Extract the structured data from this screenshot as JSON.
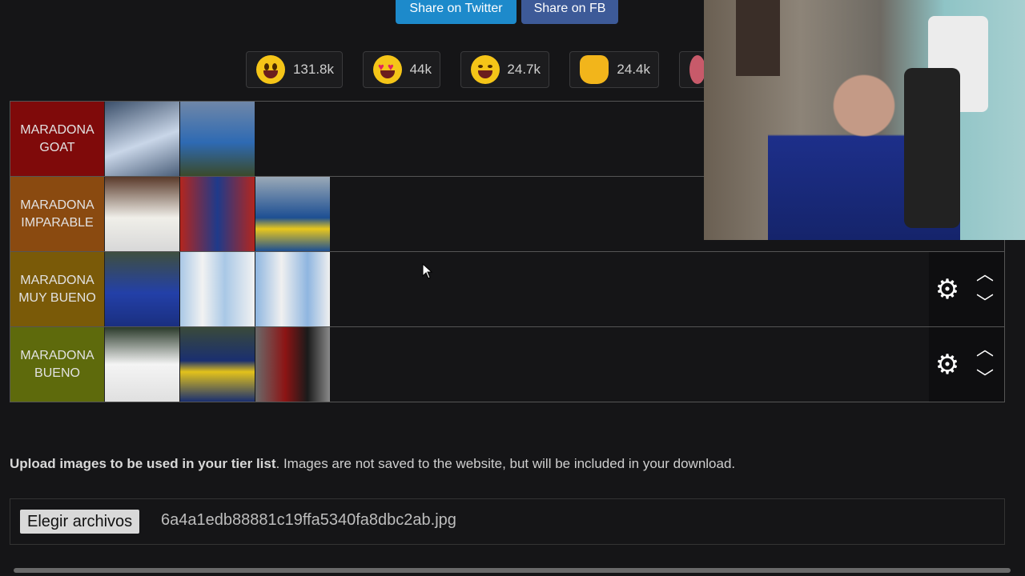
{
  "share": {
    "twitter": "Share on Twitter",
    "facebook": "Share on FB"
  },
  "reactions": [
    {
      "icon": "grinning-face-icon",
      "count": "131.8k"
    },
    {
      "icon": "heart-eyes-icon",
      "count": "44k"
    },
    {
      "icon": "laughing-tears-icon",
      "count": "24.7k"
    },
    {
      "icon": "raised-hands-icon",
      "count": "24.4k"
    }
  ],
  "tiers": [
    {
      "label": "MARADONA GOAT",
      "color": "#7f0a0a",
      "image_count": 2
    },
    {
      "label": "MARADONA IMPARABLE",
      "color": "#8a4a10",
      "image_count": 3
    },
    {
      "label": "MARADONA MUY BUENO",
      "color": "#7a5a08",
      "image_count": 3
    },
    {
      "label": "MARADONA BUENO",
      "color": "#5e6a0c",
      "image_count": 3
    }
  ],
  "upload": {
    "bold": "Upload images to be used in your tier list",
    "rest": ". Images are not saved to the website, but will be included in your download.",
    "button": "Elegir archivos",
    "filename": "6a4a1edb88881c19ffa5340fa8dbc2ab.jpg"
  }
}
